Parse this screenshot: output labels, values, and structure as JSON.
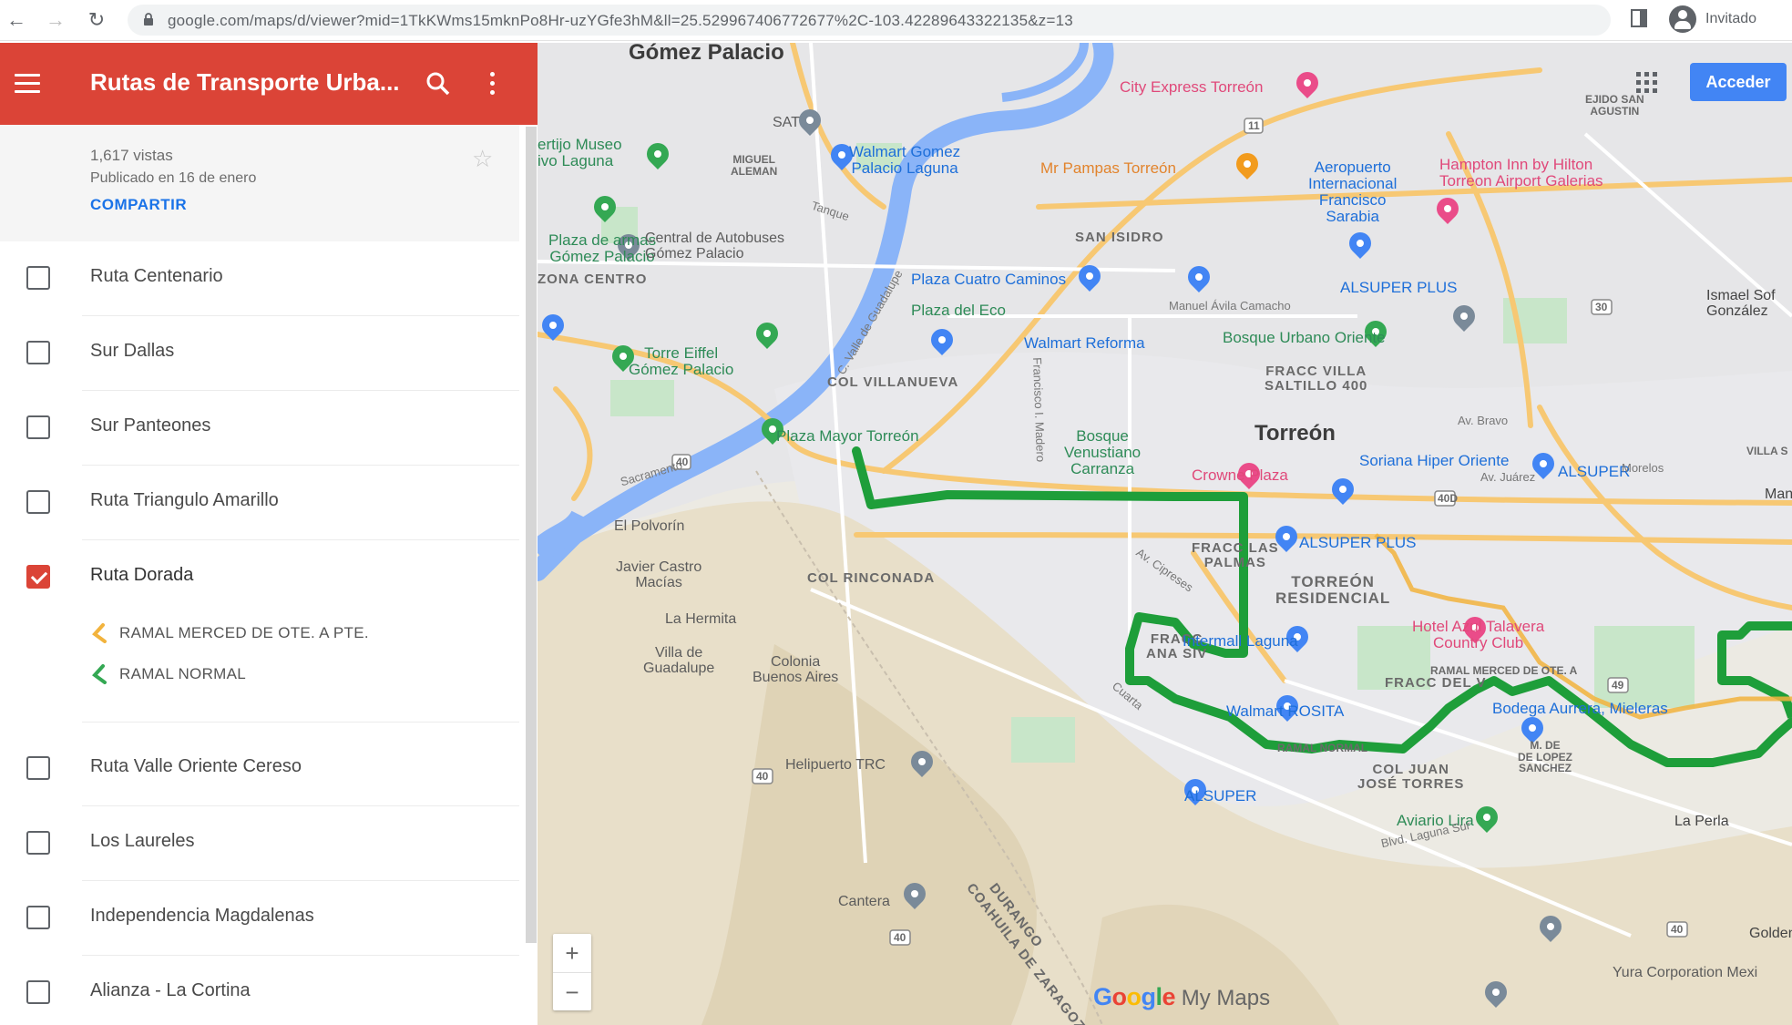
{
  "browser": {
    "url": "google.com/maps/d/viewer?mid=1TkKWms15mknPo8Hr-uzYGfe3hM&ll=25.529967406772677%2C-103.42289643322135&z=13",
    "profile_label": "Invitado"
  },
  "sidebar": {
    "title": "Rutas de Transporte Urba...",
    "views": "1,617 vistas",
    "published": "Publicado en 16 de enero",
    "share_label": "COMPARTIR",
    "layers": [
      {
        "label": "Ruta Centenario",
        "checked": false
      },
      {
        "label": "Sur Dallas",
        "checked": false
      },
      {
        "label": "Sur Panteones",
        "checked": false
      },
      {
        "label": "Ruta Triangulo Amarillo",
        "checked": false
      },
      {
        "label": "Ruta Dorada",
        "checked": true
      },
      {
        "label": "Ruta Valle Oriente Cereso",
        "checked": false
      },
      {
        "label": "Los Laureles",
        "checked": false
      },
      {
        "label": "Independencia Magdalenas",
        "checked": false
      },
      {
        "label": "Alianza - La Cortina",
        "checked": false
      }
    ],
    "sub_items": [
      {
        "label": "RAMAL MERCED DE OTE. A PTE.",
        "color": "#f2b33d"
      },
      {
        "label": "RAMAL NORMAL",
        "color": "#34a853"
      }
    ]
  },
  "map": {
    "login_label": "Acceder",
    "zoom_in": "+",
    "zoom_out": "−",
    "brand_google": "Google",
    "brand_product": "My Maps",
    "route_color": "#1e9e3a",
    "labels": {
      "gomez_palacio": "Gómez Palacio",
      "torreon": "Torreón",
      "city_express": "City Express Torreón",
      "walmart_gomez": "Walmart Gomez\nPalacio Laguna",
      "mr_pampas": "Mr Pampas Torreón",
      "aeropuerto": "Aeropuerto\nInternacional\nFrancisco\nSarabia",
      "hampton": "Hampton Inn by Hilton\nTorreon Airport Galerias",
      "ejido": "EJIDO SAN\nAGUSTIN",
      "miguel_aleman": "MIGUEL\nALEMAN",
      "museo": "ertijo Museo\nivo Laguna",
      "plaza_armas": "Plaza de armas\nGómez Palacio",
      "zona_centro": "ZONA CENTRO",
      "central_autobuses": "Central de Autobuses\nGómez Palacio",
      "san_isidro": "SAN ISIDRO",
      "plaza_cuatro": "Plaza Cuatro Caminos",
      "alsuper_plus_1": "ALSUPER PLUS",
      "ismael": "Ismael Sof\nGonzález",
      "plaza_eco": "Plaza del Eco",
      "walmart_reforma": "Walmart Reforma",
      "bosque_urbano": "Bosque Urbano Oriente",
      "torre_eiffel": "Torre Eiffel\nGómez Palacio",
      "col_villanueva": "COL VILLANUEVA",
      "fracc_villa": "FRACC VILLA\nSALTILLO 400",
      "plaza_mayor": "Plaza Mayor Torreón",
      "bosque_venustiano": "Bosque\nVenustiano\nCarranza",
      "crowne": "Crowne Plaza",
      "soriana": "Soriana Hiper Oriente",
      "alsuper_2": "ALSUPER",
      "villa": "VILLA S",
      "el_polvorin": "El Polvorín",
      "fracc_palmas": "FRACC LAS\nPALMAS",
      "alsuper_plus_2": "ALSUPER PLUS",
      "javier_castro": "Javier Castro\nMacías",
      "col_rinconada": "COL RINCONADA",
      "torreon_residencial": "TORREÓN\nRESIDENCIAL",
      "la_hermita": "La Hermita",
      "fracc_ana": "FRACC\nANA SIV",
      "intermall": "Intermall Laguna",
      "hotel_azul": "Hotel Azul Talavera\nCountry Club",
      "villa_guadalupe": "Villa de\nGuadalupe",
      "colonia_ba": "Colonia\nBuenos Aires",
      "ramal_merced_map": "RAMAL MERCED DE OTE. A",
      "fracc_del": "FRACC DEL V",
      "walmart_rosita": "Walmart ROSITA",
      "bodega": "Bodega Aurrera, Mieleras",
      "ramal_normal_map": "RAMAL NORMAL",
      "m_lopez": "M. DE\nDE LOPEZ\nSANCHEZ",
      "helipuerto": "Helipuerto TRC",
      "col_juan": "COL JUAN\nJOSÉ TORRES",
      "alsuper_3": "ALSUPER",
      "aviario": "Aviario Lira",
      "la_perla": "La Perla",
      "coahuila": "COAHUILA DE ZARAGOZA",
      "durango": "DURANGO",
      "cantera": "Cantera",
      "golden": "Golden L",
      "yura": "Yura Corporation Mexi",
      "manuel_avila": "Manuel Ávila Camacho",
      "av_bravo": "Av. Bravo",
      "av_juarez": "Av. Juárez",
      "morelos": "Morelos",
      "manto": "Manto",
      "sacramento": "Sacramento",
      "blvd_laguna": "Blvd. Laguna Sur",
      "fco_madero": "Francisco I. Madero",
      "av_cipreses": "Av. Cipreses",
      "cuarta": "Cuarta",
      "tanque": "Tanque",
      "valle_guad": "C. Valle de Guadalupe",
      "hwy_40": "40",
      "hwy_40d": "40D",
      "hwy_40b": "40",
      "hwy_40c": "40",
      "hwy_40e": "40",
      "hwy_30": "30",
      "hwy_49": "49",
      "hwy_11": "11",
      "sat": "SAT"
    }
  }
}
